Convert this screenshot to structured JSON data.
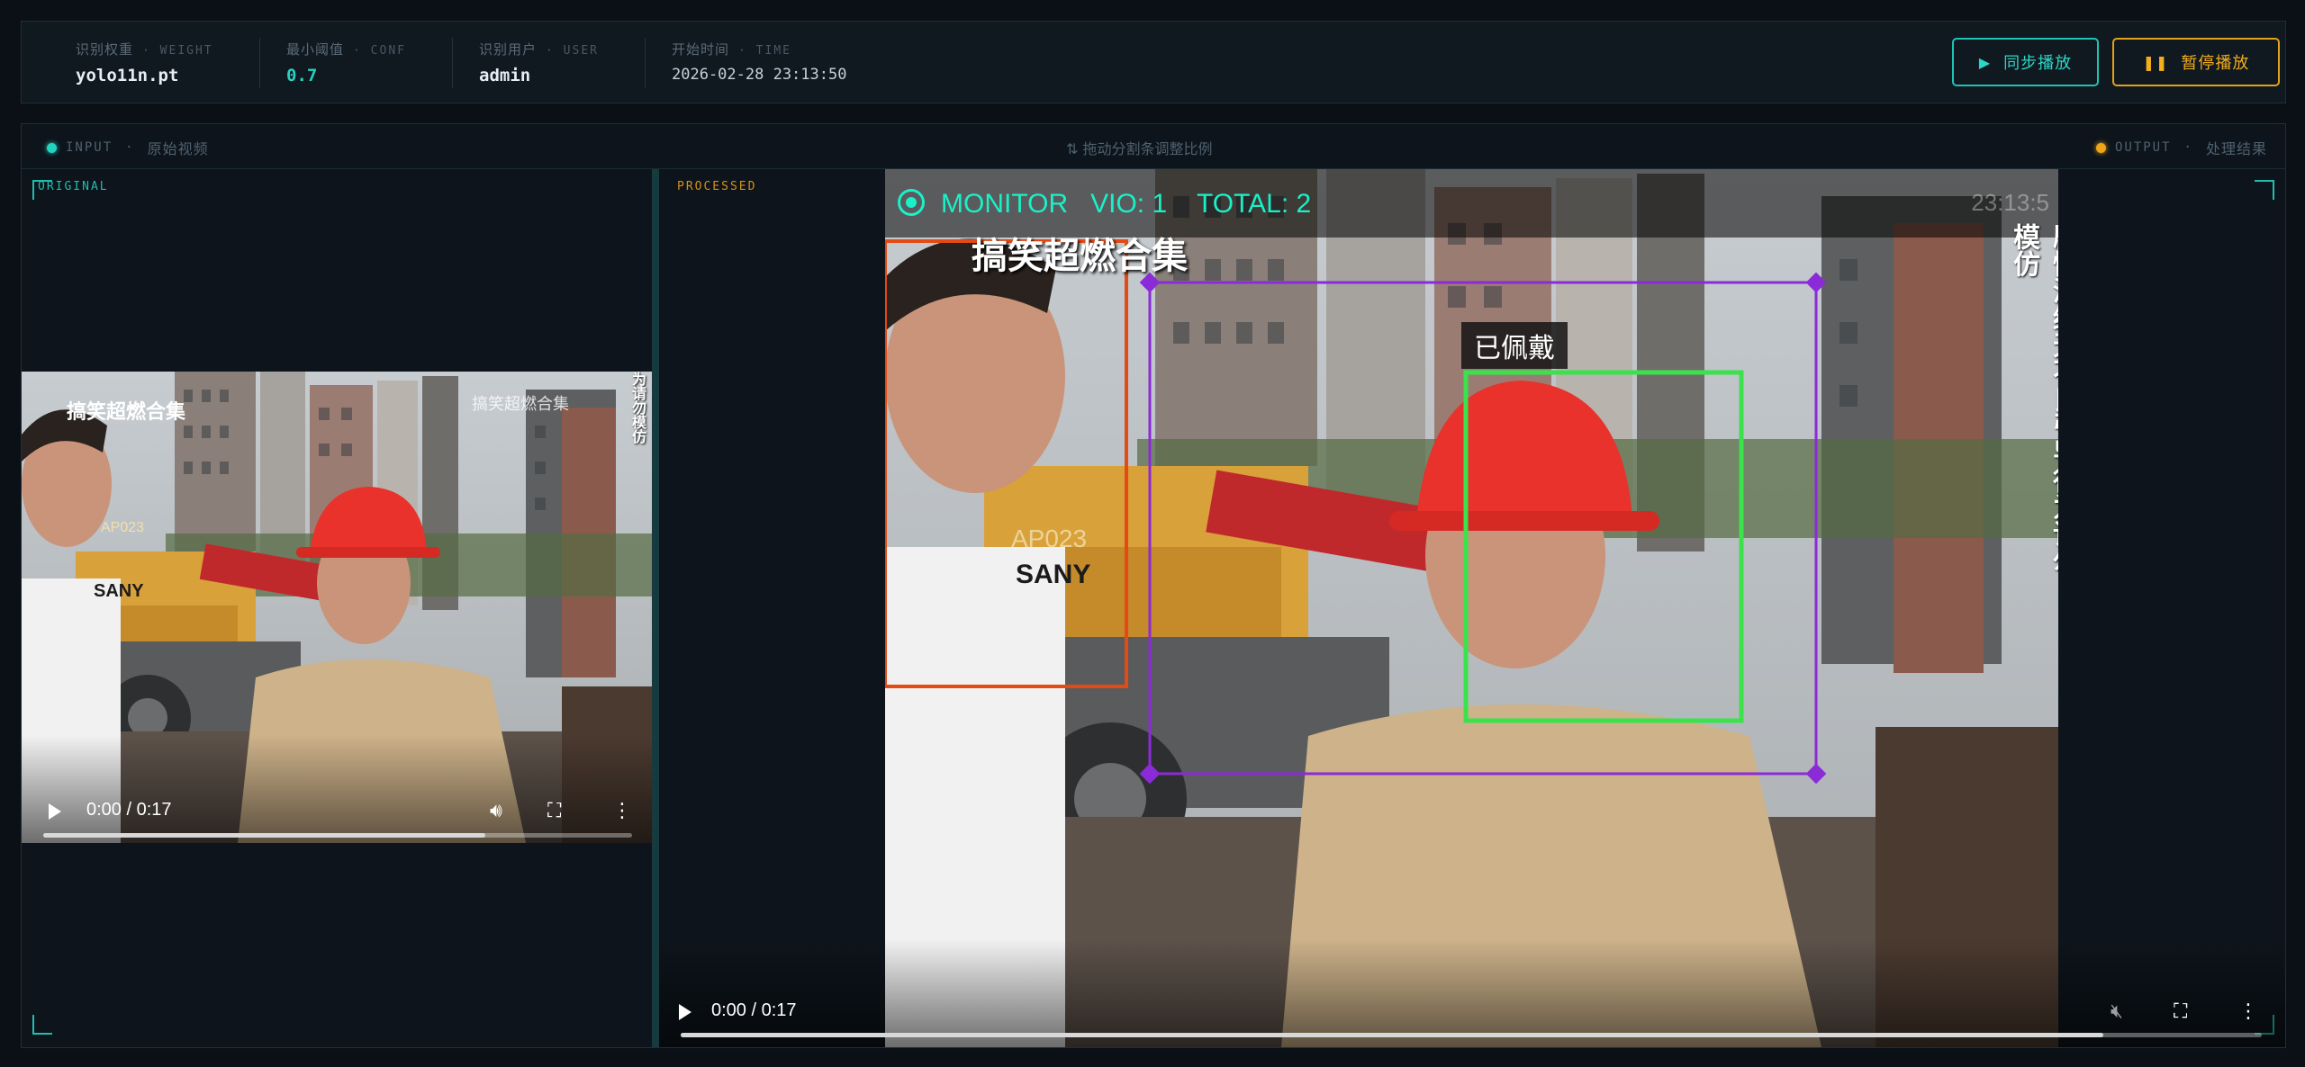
{
  "topbar": {
    "weight": {
      "label": "识别权重",
      "sub": "· WEIGHT",
      "value": "yolo11n.pt"
    },
    "conf": {
      "label": "最小阈值",
      "sub": "· CONF",
      "value": "0.7"
    },
    "user": {
      "label": "识别用户",
      "sub": "· USER",
      "value": "admin"
    },
    "time": {
      "label": "开始时间",
      "sub": "· TIME",
      "value": "2026-02-28 23:13:50"
    },
    "sync_button": "同步播放",
    "pause_button": "暂停播放"
  },
  "panel": {
    "input_tag": "INPUT",
    "input_label": "原始视频",
    "splitter_hint": "拖动分割条调整比例",
    "output_tag": "OUTPUT",
    "output_label": "处理结果"
  },
  "original": {
    "tag": "ORIGINAL",
    "timecode": "0:00 / 0:17",
    "progress": 0.75,
    "overlay_title": "搞笑超燃合集",
    "overlay_watermark": "搞笑超燃合集",
    "side_text": "剧情演绎无不良引导行为请勿模仿"
  },
  "processed": {
    "tag": "PROCESSED",
    "timecode": "0:00 / 0:17",
    "progress": 0.9,
    "hud": "MONITOR   VIO: 1    TOTAL: 2",
    "hud_time": "23:13:5",
    "overlay_title": "搞笑超燃合集",
    "detection_label": "已佩戴",
    "side_text": "剧情演绎无不良引导行为请勿模仿"
  },
  "icons": {
    "play": "play-icon",
    "pause": "pause-icon",
    "volume": "volume-icon",
    "fullscreen": "fullscreen-icon",
    "more": "more-vert-icon",
    "updown": "up-down-arrows-icon"
  },
  "colors": {
    "accent_teal": "#1fc3b3",
    "accent_amber": "#e2a21a",
    "hud_green": "#19f1c8",
    "box_green": "#3be24c",
    "box_purple": "#8b2bd8",
    "box_orange": "#e44a13"
  }
}
